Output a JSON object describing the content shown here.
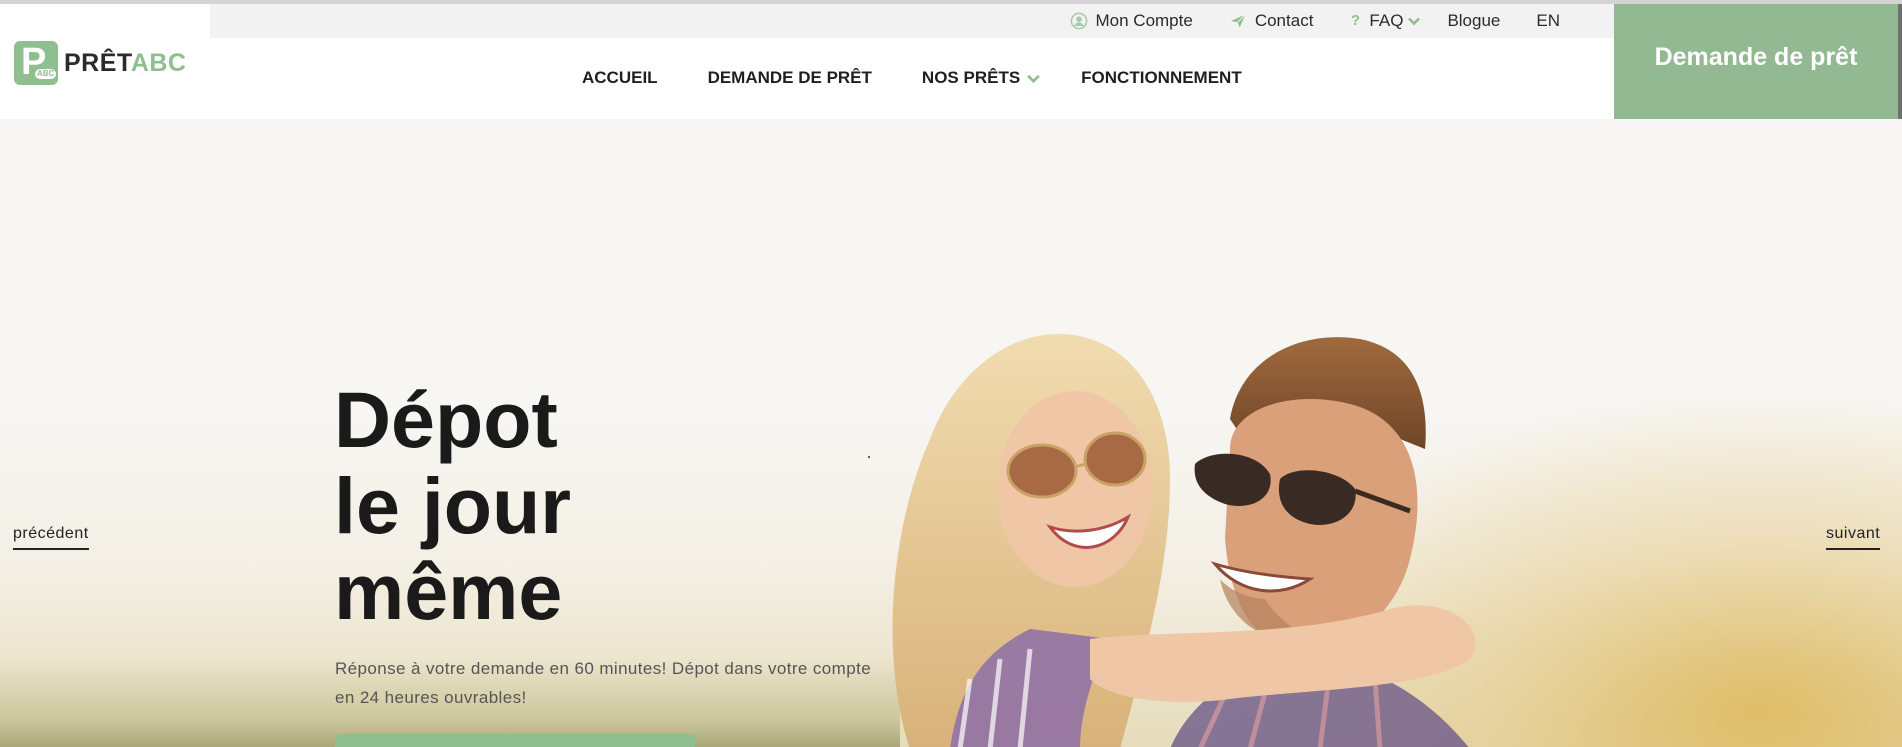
{
  "utility_nav": {
    "account": "Mon Compte",
    "contact": "Contact",
    "faq": "FAQ",
    "faq_mark": "?",
    "blog": "Blogue",
    "lang": "EN"
  },
  "logo": {
    "text_dark": "PRÊT",
    "text_green": "ABC",
    "badge_letter": "P",
    "badge_small": "ABC"
  },
  "main_nav": [
    {
      "label": "ACCUEIL"
    },
    {
      "label": "DEMANDE DE PRÊT"
    },
    {
      "label": "NOS PRÊTS"
    },
    {
      "label": "FONCTIONNEMENT"
    }
  ],
  "cta": {
    "label": "Demande de prêt"
  },
  "hero": {
    "title_lines": [
      "Dépot",
      "le jour",
      "même"
    ],
    "description": "Réponse à votre demande en 60 minutes! Dépot dans votre compte en 24 heures ouvrables!",
    "prev": "précédent",
    "next": "suivant"
  },
  "icons": {
    "account": "user-circle-icon",
    "contact": "paper-plane-icon",
    "faq": "question-icon",
    "dropdown": "chevron-down-icon"
  },
  "colors": {
    "brand_green": "#8fbe8f",
    "cta_green": "#93b992",
    "text_dark": "#1a1a1a"
  }
}
